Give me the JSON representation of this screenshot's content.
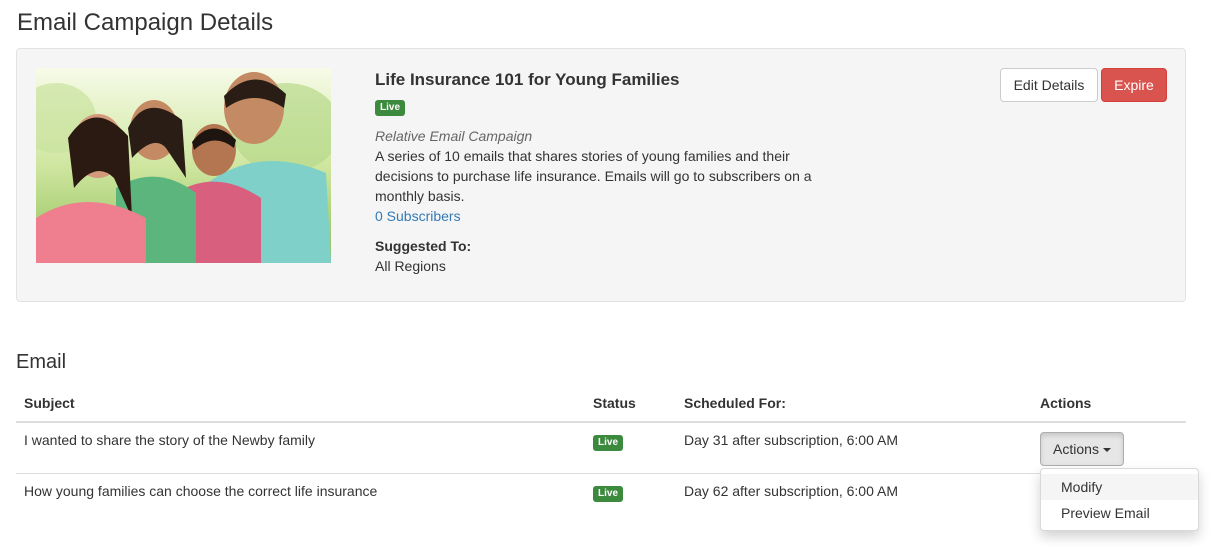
{
  "page": {
    "title": "Email Campaign Details"
  },
  "campaign": {
    "name": "Life Insurance 101 for Young Families",
    "status": "Live",
    "type": "Relative Email Campaign",
    "description": "A series of 10 emails that shares stories of young families and their decisions to purchase life insurance. Emails will go to subscribers on a monthly basis.",
    "subscribers": "0 Subscribers",
    "suggested_label": "Suggested To:",
    "suggested_value": "All Regions",
    "image_alt": "Family photo: parents with two children outdoors",
    "edit_label": "Edit Details",
    "expire_label": "Expire"
  },
  "email_section": {
    "title": "Email",
    "columns": {
      "subject": "Subject",
      "status": "Status",
      "scheduled": "Scheduled For:",
      "actions": "Actions"
    },
    "rows": [
      {
        "subject": "I wanted to share the story of the Newby family",
        "status": "Live",
        "scheduled": "Day 31 after subscription, 6:00 AM"
      },
      {
        "subject": "How young families can choose the correct life insurance",
        "status": "Live",
        "scheduled": "Day 62 after subscription, 6:00 AM"
      }
    ],
    "actions_button": "Actions",
    "dropdown": {
      "items": [
        "Modify",
        "Preview Email"
      ]
    }
  },
  "colors": {
    "live_badge": "#3c8a3e",
    "expire_button": "#d9534f",
    "link": "#337ab7",
    "panel_bg": "#f5f5f5"
  }
}
